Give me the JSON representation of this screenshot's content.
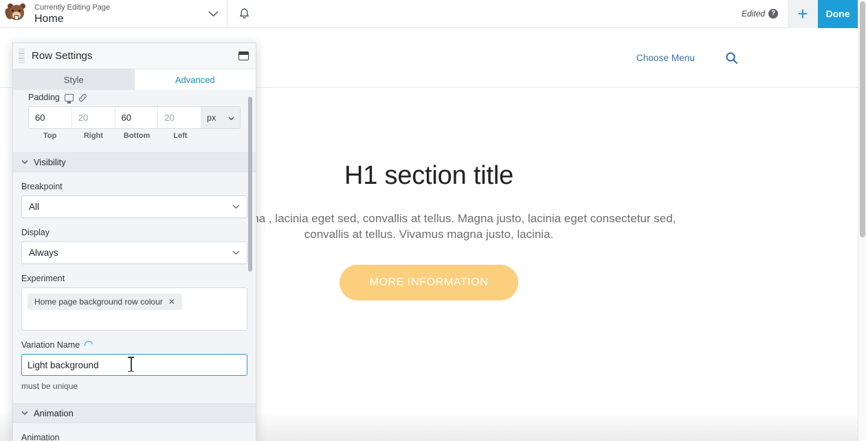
{
  "admin_bar": {
    "logo_icon": "beaver-logo-icon",
    "currently_editing_label": "Currently Editing Page",
    "page_name": "Home",
    "chevron_icon": "chevron-down-icon",
    "bell_icon": "bell-icon",
    "edited_label": "Edited",
    "help_badge": "?",
    "add_label": "+",
    "done_label": "Done"
  },
  "site_header": {
    "choose_menu_label": "Choose Menu",
    "search_icon": "search-icon"
  },
  "hero": {
    "heading": "H1 section title",
    "body": "Vivamus magna , lacinia eget  sed, convallis at tellus.  Magna justo, lacinia eget consectetur sed, convallis at tellus. Vivamus magna justo, lacinia.",
    "cta_label": "MORE INFORMATION",
    "cta_color": "#fbcf7d"
  },
  "panel": {
    "title": "Row Settings",
    "grip_icon": "drag-handle-icon",
    "dock_icon": "dock-window-icon",
    "tabs": [
      {
        "label": "Style",
        "active": false
      },
      {
        "label": "Advanced",
        "active": true
      }
    ],
    "padding": {
      "label": "Padding",
      "responsive_icon": "monitor-icon",
      "link_icon": "link-icon",
      "top": "60",
      "right": "20",
      "bottom": "60",
      "left": "20",
      "top_name": "Top",
      "right_name": "Right",
      "bottom_name": "Bottom",
      "left_name": "Left",
      "unit": "px",
      "unit_chevron_icon": "chevron-down-icon"
    },
    "visibility": {
      "section_label": "Visibility",
      "section_chevron_icon": "chevron-down-icon",
      "breakpoint_label": "Breakpoint",
      "breakpoint_value": "All",
      "display_label": "Display",
      "display_value": "Always",
      "experiment_label": "Experiment",
      "experiment_chip": "Home page background row colour",
      "experiment_chip_remove_icon": "close-icon",
      "variation_name_label": "Variation Name",
      "variation_spinner_icon": "loading-spinner-icon",
      "variation_name_value": "Light background",
      "variation_helper": "must be unique"
    },
    "animation": {
      "section_label": "Animation",
      "section_chevron_icon": "chevron-down-icon",
      "field_label": "Animation"
    }
  },
  "colors": {
    "accent_blue": "#1e8cbe",
    "done_blue": "#1d9ed9",
    "panel_bg": "#f2f4f7",
    "focus_border": "#2a9ad1"
  }
}
